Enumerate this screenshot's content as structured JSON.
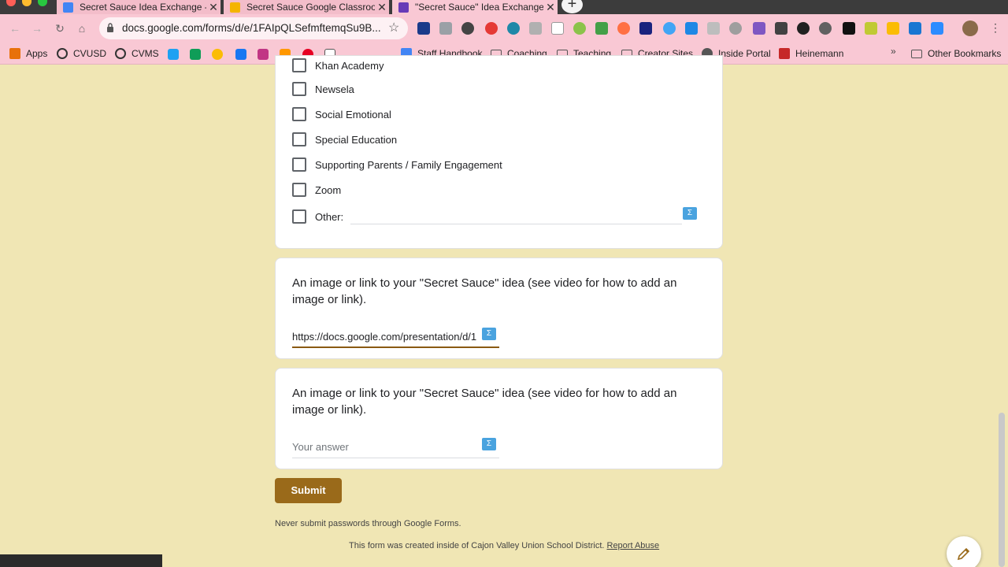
{
  "browser": {
    "tabs": [
      {
        "title": "Secret Sauce Idea Exchange - ",
        "favicon_color": "#4285f4"
      },
      {
        "title": "Secret Sauce Google Classroo",
        "favicon_color": "#f4b400"
      },
      {
        "title": "\"Secret Sauce\" Idea Exchange",
        "favicon_color": "#673ab7"
      }
    ],
    "tab_close": "✕",
    "new_tab": "+",
    "url": "docs.google.com/forms/d/e/1FAIpQLSefmftemqSu9B...",
    "bookmarks": [
      {
        "label": "Apps"
      },
      {
        "label": "CVUSD"
      },
      {
        "label": "CVMS"
      },
      {
        "label": "Staff Handbook"
      },
      {
        "label": "Coaching"
      },
      {
        "label": "Teaching"
      },
      {
        "label": "Creator Sites"
      },
      {
        "label": "Inside Portal"
      },
      {
        "label": "Heinemann"
      },
      {
        "label": "Other Bookmarks"
      }
    ],
    "overflow_chevron": "»"
  },
  "form": {
    "partial_option": "Khan Academy",
    "options": [
      "Newsela",
      "Social Emotional",
      "Special Education",
      "Supporting Parents / Family Engagement",
      "Zoom"
    ],
    "other_label": "Other:",
    "questions": [
      {
        "title": "An image or link to your \"Secret Sauce\" idea (see video for how to add an image or link).",
        "answer": "https://docs.google.com/presentation/d/1"
      },
      {
        "title": "An image or link to your \"Secret Sauce\" idea (see video for how to add an image or link).",
        "placeholder": "Your answer"
      }
    ],
    "submit_label": "Submit",
    "password_warning": "Never submit passwords through Google Forms.",
    "footer_text": "This form was created inside of Cajon Valley Union School District.",
    "report_abuse": "Report Abuse",
    "sigma_label": "Σ"
  }
}
